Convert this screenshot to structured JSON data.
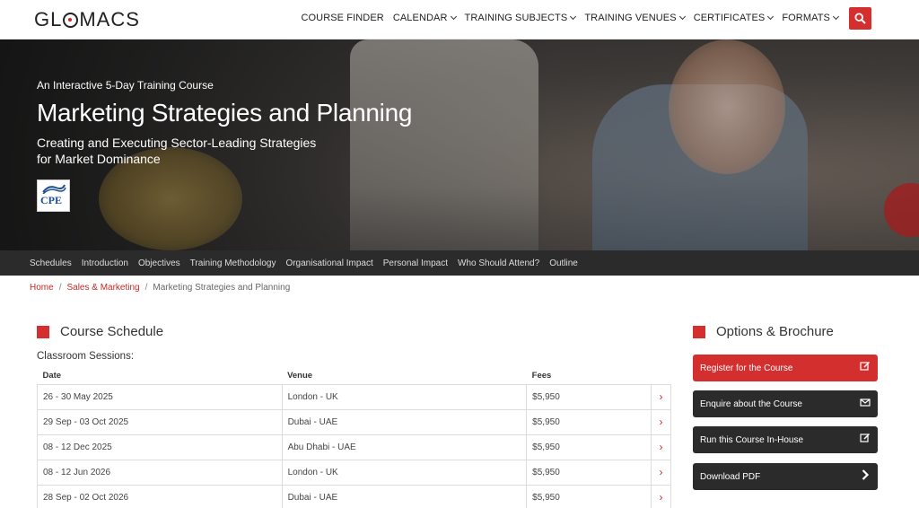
{
  "header": {
    "logo_text_pre": "GL",
    "logo_text_post": "MACS",
    "nav": [
      {
        "label": "COURSE FINDER",
        "dropdown": false
      },
      {
        "label": "CALENDAR",
        "dropdown": true
      },
      {
        "label": "TRAINING SUBJECTS",
        "dropdown": true
      },
      {
        "label": "TRAINING VENUES",
        "dropdown": true
      },
      {
        "label": "CERTIFICATES",
        "dropdown": true
      },
      {
        "label": "FORMATS",
        "dropdown": true
      }
    ],
    "search_icon": "search-icon",
    "accent_color": "#d32f2f"
  },
  "hero": {
    "tagline": "An Interactive 5-Day Training Course",
    "title": "Marketing Strategies and Planning",
    "subtitle": "Creating and Executing Sector-Leading Strategies for Market Dominance",
    "badge_text": "CPE"
  },
  "subnav": [
    "Schedules",
    "Introduction",
    "Objectives",
    "Training Methodology",
    "Organisational Impact",
    "Personal Impact",
    "Who Should Attend?",
    "Outline"
  ],
  "breadcrumb": {
    "home": "Home",
    "sep": "/",
    "category": "Sales & Marketing",
    "current": "Marketing Strategies and Planning"
  },
  "schedule": {
    "title": "Course Schedule",
    "subtitle": "Classroom Sessions:",
    "columns": [
      "Date",
      "Venue",
      "Fees"
    ],
    "rows": [
      {
        "date": "26 - 30 May 2025",
        "venue": "London - UK",
        "fee": "$5,950"
      },
      {
        "date": "29 Sep - 03 Oct 2025",
        "venue": "Dubai - UAE",
        "fee": "$5,950"
      },
      {
        "date": "08 - 12 Dec 2025",
        "venue": "Abu Dhabi - UAE",
        "fee": "$5,950"
      },
      {
        "date": "08 - 12 Jun 2026",
        "venue": "London - UK",
        "fee": "$5,950"
      },
      {
        "date": "28 Sep - 02 Oct 2026",
        "venue": "Dubai - UAE",
        "fee": "$5,950"
      }
    ],
    "row_arrow": "›"
  },
  "options": {
    "title": "Options & Brochure",
    "buttons": [
      {
        "label": "Register for the Course",
        "icon": "edit-icon",
        "style": "red"
      },
      {
        "label": "Enquire about the Course",
        "icon": "envelope-icon",
        "style": "dark"
      },
      {
        "label": "Run this Course In-House",
        "icon": "edit-icon",
        "style": "dark"
      },
      {
        "label": "Download PDF",
        "icon": "chevron-right-icon",
        "style": "dark"
      }
    ]
  }
}
